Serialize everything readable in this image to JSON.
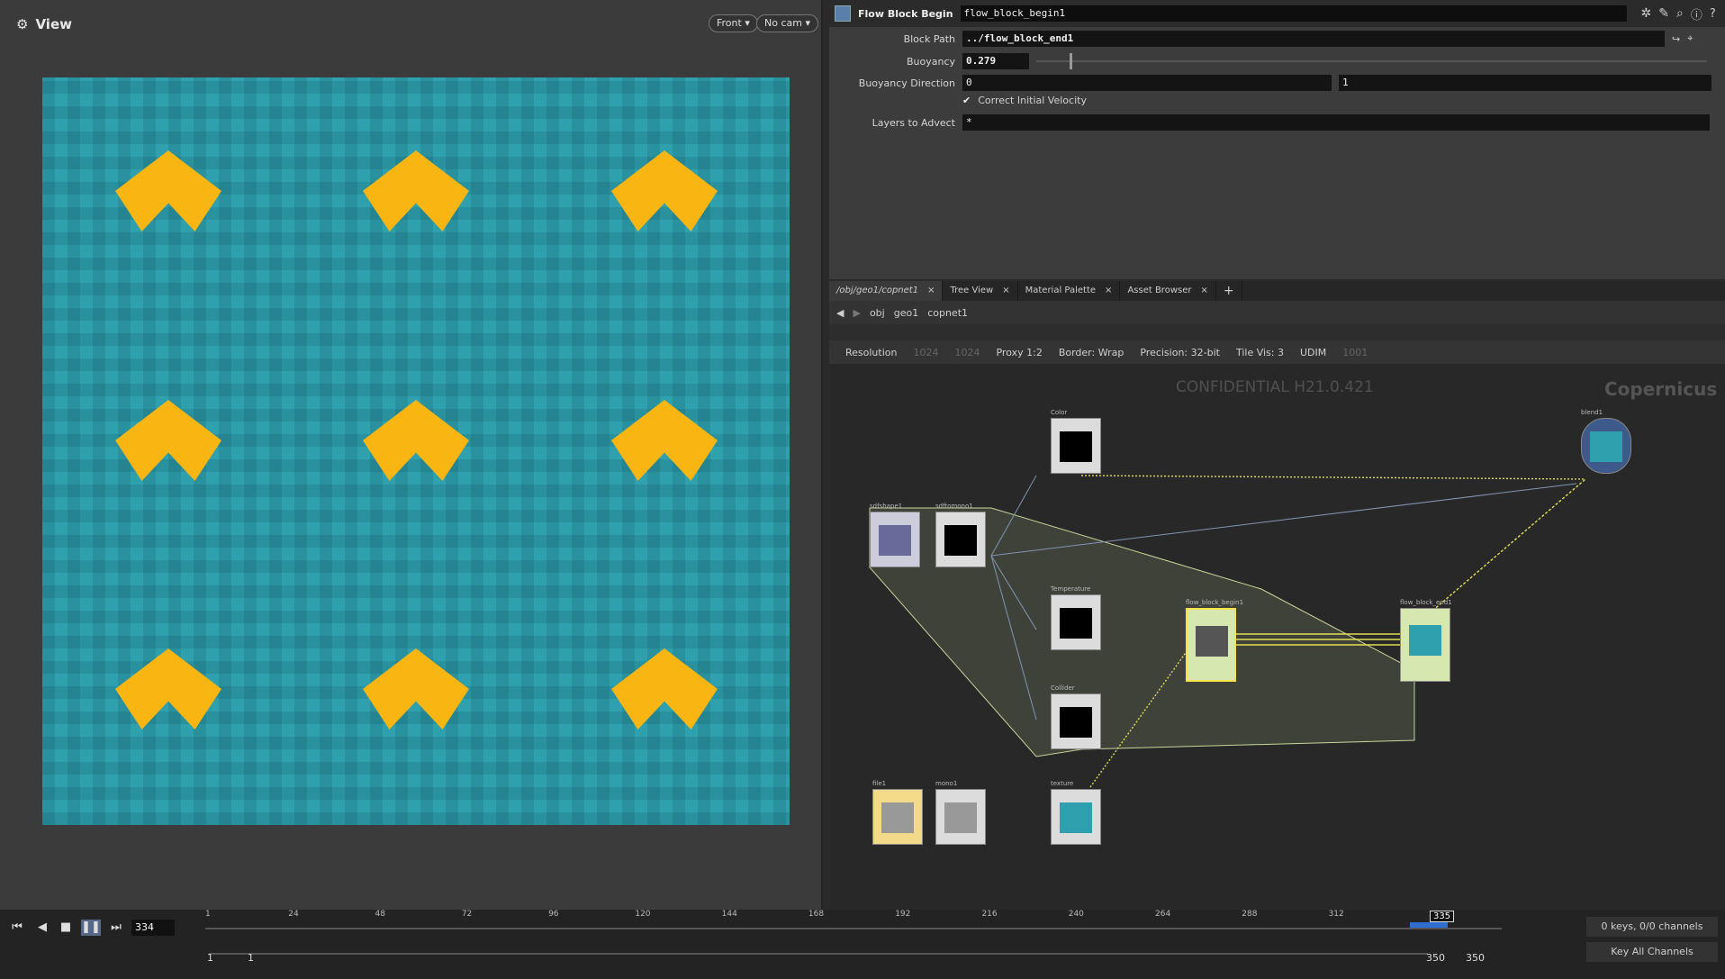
{
  "viewport": {
    "title": "View",
    "view_menu": "Front",
    "cam_menu": "No cam"
  },
  "params": {
    "node_type": "Flow Block Begin",
    "node_name": "flow_block_begin1",
    "block_path_label": "Block Path",
    "block_path": "../flow_block_end1",
    "buoyancy_label": "Buoyancy",
    "buoyancy": "0.279",
    "buoyancy_fraction": 0.05,
    "buoyancy_dir_label": "Buoyancy Direction",
    "buoyancy_dir_x": "0",
    "buoyancy_dir_y": "1",
    "correct_velocity": "Correct Initial Velocity",
    "layers_label": "Layers to Advect",
    "layers": "*"
  },
  "tabs": [
    "/obj/geo1/copnet1",
    "Tree View",
    "Material Palette",
    "Asset Browser"
  ],
  "path": [
    "obj",
    "geo1",
    "copnet1"
  ],
  "netopts": {
    "resolution": "Resolution",
    "res_x": "1024",
    "res_y": "1024",
    "proxy": "Proxy 1:2",
    "border": "Border: Wrap",
    "precision": "Precision: 32-bit",
    "tilevis": "Tile Vis: 3",
    "udim": "UDIM",
    "udim_val": "1001"
  },
  "watermark": "CONFIDENTIAL H21.0.421",
  "brand": "Copernicus",
  "nodes": {
    "color": "Color",
    "sdfshape": "sdfshape1",
    "sdftomono": "sdftomono1",
    "temperature": "Temperature",
    "collider": "Collider",
    "begin": "flow_block_begin1",
    "end": "flow_block_end1",
    "blend": "blend1",
    "file": "file1",
    "mono": "mono1",
    "texture": "texture"
  },
  "timeline": {
    "frame": "334",
    "current": "335",
    "start": "1",
    "start2": "1",
    "end": "350",
    "end2": "350",
    "ticks": [
      "1",
      "24",
      "48",
      "72",
      "96",
      "120",
      "144",
      "168",
      "192",
      "216",
      "240",
      "264",
      "288",
      "312"
    ],
    "keys": "0 keys, 0/0 channels",
    "keyall": "Key All Channels"
  }
}
